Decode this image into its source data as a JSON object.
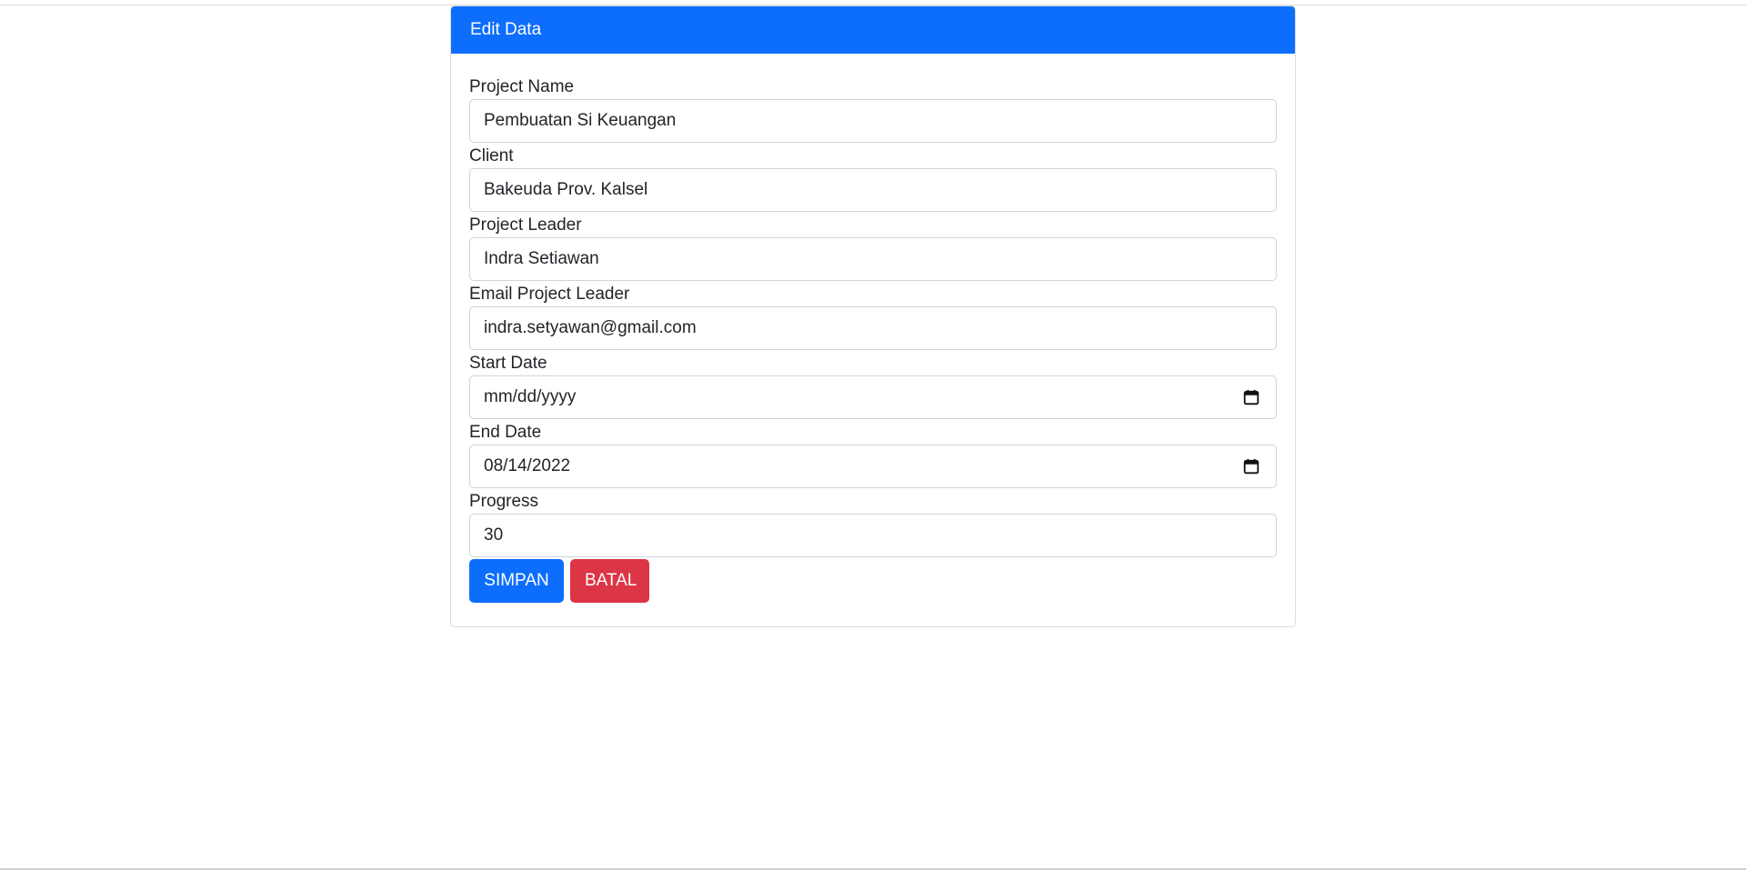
{
  "card": {
    "title": "Edit Data"
  },
  "form": {
    "fields": [
      {
        "label": "Project Name",
        "value": "Pembuatan Si Keuangan",
        "type": "text"
      },
      {
        "label": "Client",
        "value": "Bakeuda Prov. Kalsel",
        "type": "text"
      },
      {
        "label": "Project Leader",
        "value": "Indra Setiawan",
        "type": "text"
      },
      {
        "label": "Email Project Leader",
        "value": "indra.setyawan@gmail.com",
        "type": "email"
      },
      {
        "label": "Start Date",
        "value": "mm/dd/yyyy",
        "type": "date"
      },
      {
        "label": "End Date",
        "value": "08/14/2022",
        "type": "date"
      },
      {
        "label": "Progress",
        "value": "30",
        "type": "number"
      }
    ],
    "save_label": "SIMPAN",
    "cancel_label": "BATAL"
  },
  "colors": {
    "primary": "#0d6efd",
    "danger": "#dc3545"
  }
}
